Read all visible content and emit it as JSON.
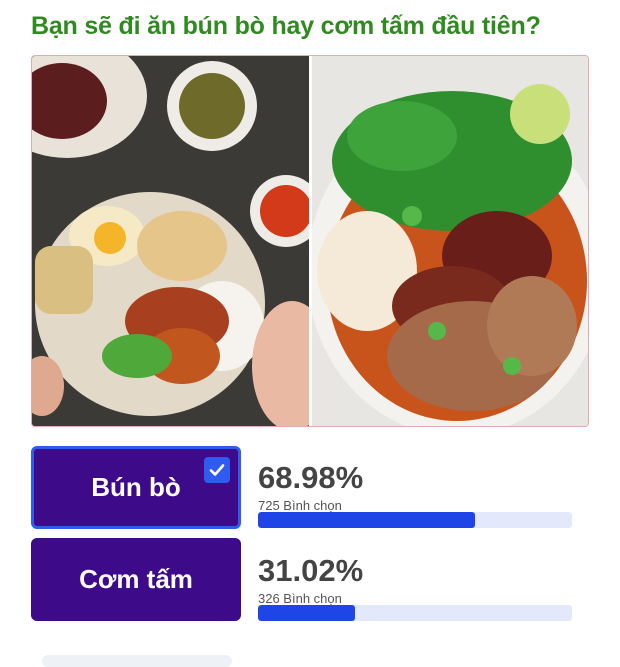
{
  "poll": {
    "question": "Bạn sẽ đi ăn bún bò hay cơm tấm đầu tiên?",
    "options": [
      {
        "label": "Bún bò",
        "percent_text": "68.98%",
        "votes_text": "725 Bình chọn",
        "fraction": 0.6898,
        "selected": true
      },
      {
        "label": "Cơm tấm",
        "percent_text": "31.02%",
        "votes_text": "326 Bình chọn",
        "fraction": 0.3102,
        "selected": false
      }
    ]
  },
  "images": {
    "left": "com-tam-photo",
    "right": "bun-bo-photo"
  },
  "icons": {
    "selected": "checkmark-icon"
  },
  "colors": {
    "question": "#2f8a1f",
    "button_bg": "#3d0a8a",
    "selected_border": "#2f5bf0",
    "bar_fill": "#1f45e6",
    "bar_track": "#e3e9fb"
  }
}
